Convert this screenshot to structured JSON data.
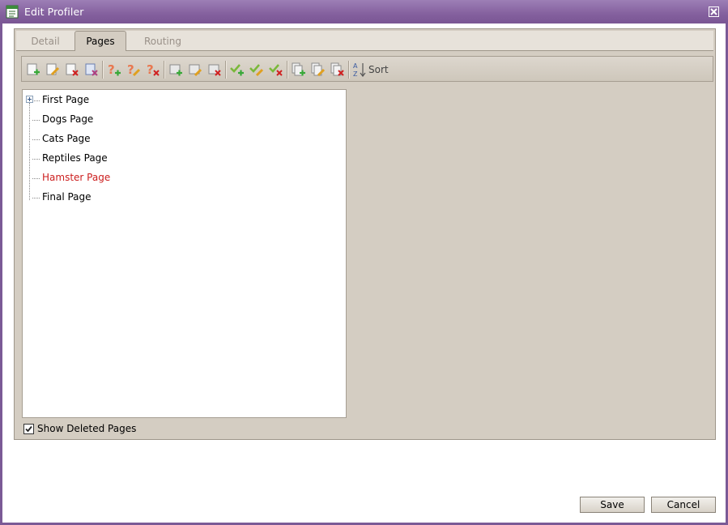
{
  "window": {
    "title": "Edit Profiler"
  },
  "tabs": [
    {
      "label": "Detail",
      "active": false
    },
    {
      "label": "Pages",
      "active": true
    },
    {
      "label": "Routing",
      "active": false
    }
  ],
  "toolbar": {
    "sort_label": "Sort",
    "buttons": [
      "add-page-icon",
      "edit-page-icon",
      "delete-page-icon",
      "restore-page-icon",
      "add-question-icon",
      "edit-question-icon",
      "delete-question-icon",
      "add-item-icon",
      "edit-item-icon",
      "delete-item-icon",
      "add-check-icon",
      "edit-check-icon",
      "delete-check-icon",
      "add-copy-icon",
      "edit-copy-icon",
      "delete-copy-icon"
    ]
  },
  "tree": {
    "nodes": [
      {
        "label": "First Page",
        "expandable": true
      },
      {
        "label": "Dogs Page"
      },
      {
        "label": "Cats Page"
      },
      {
        "label": "Reptiles Page"
      },
      {
        "label": "Hamster Page",
        "highlight": true
      },
      {
        "label": "Final Page"
      }
    ]
  },
  "show_deleted": {
    "label": "Show Deleted Pages",
    "checked": true
  },
  "footer": {
    "save_label": "Save",
    "cancel_label": "Cancel"
  },
  "colors": {
    "title_bar": "#84609e",
    "highlight_text": "#cc1e1e",
    "panel": "#d4cdc2"
  }
}
